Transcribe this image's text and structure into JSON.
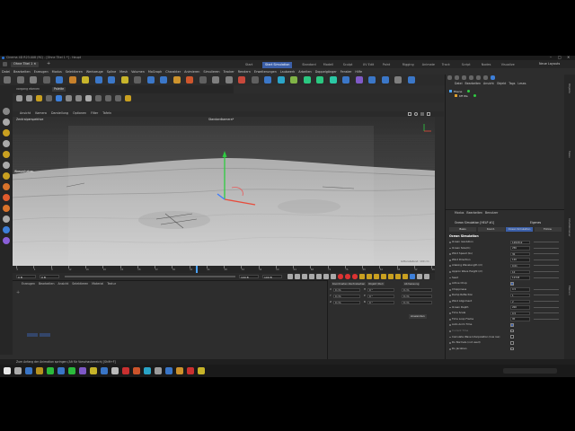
{
  "window": {
    "title": "Cinema 4D R23.008 (RC) - [Ohne Titel 1 *] - Haupt",
    "doc_tab": "Ohne Titel 1",
    "layout_label": "Neue Layouts"
  },
  "top_tabs": [
    "Start",
    "Start Simulation",
    "Standard",
    "Modell",
    "Sculpt",
    "UV Edit",
    "Paint",
    "Rigging",
    "Animate",
    "Track",
    "Script",
    "Nodes",
    "Visualize"
  ],
  "active_top_tab": 1,
  "main_menu": [
    "Datei",
    "Bearbeiten",
    "Erzeugen",
    "Modus",
    "Selektieren",
    "Werkzeuge",
    "Spline",
    "Mesh",
    "Volumen",
    "MoGraph",
    "Charakter",
    "Animieren",
    "Simulieren",
    "Tracker",
    "Rendern",
    "Erweiterungen",
    "Laubwerk",
    "Arbeiten",
    "Doppelgänger",
    "Fenster",
    "Hilfe"
  ],
  "left_strip": {
    "tab1": "vorgang ebenen",
    "tab2": "Palette"
  },
  "viewport": {
    "menu": [
      "Ansicht",
      "Kamera",
      "Darstellung",
      "Optionen",
      "Filter",
      "Tafeln"
    ],
    "camera_label": "Zentralperspektive",
    "default_camera": "Standardkamera*",
    "object_label": "Wasserheben",
    "grid_info": "Gitterabstand: 100 cm"
  },
  "timeline": {
    "ticks": [
      "0",
      "4",
      "8",
      "12",
      "16",
      "20",
      "24",
      "28",
      "32",
      "36",
      "40",
      "44",
      "48",
      "52",
      "56",
      "60",
      "64",
      "68",
      "72",
      "76",
      "80",
      "84",
      "88",
      "92",
      "96"
    ],
    "current_frame": "0 B",
    "start": "0 B",
    "end": "100 B",
    "end2": "100 B"
  },
  "material_manager": {
    "menu": [
      "Erzeugen",
      "Bearbeiten",
      "Ansicht",
      "Selektieren",
      "Material",
      "Textur"
    ]
  },
  "coordinates": {
    "headers": [
      "Koordinaten Zentralsehen",
      "Objekt (Rel)",
      "Abmessung"
    ],
    "rows": [
      {
        "axis": "X",
        "pos": "0 cm",
        "rot_axis": "H",
        "rot": "0 °",
        "size": "0 cm"
      },
      {
        "axis": "Y",
        "pos": "0 cm",
        "rot_axis": "P",
        "rot": "0 °",
        "size": "0 cm"
      },
      {
        "axis": "Z",
        "pos": "0 cm",
        "rot_axis": "B",
        "rot": "0 °",
        "size": "0 cm"
      }
    ],
    "apply": "Anwenden"
  },
  "object_manager": {
    "menu": [
      "Datei",
      "Bearbeiten",
      "Ansicht",
      "Objekt",
      "Tags",
      "Lesez."
    ],
    "objects": [
      {
        "name": "Ebene",
        "depth": 0
      },
      {
        "name": "Kff Wa",
        "depth": 1
      }
    ]
  },
  "attribute_manager": {
    "menu": [
      "Modus",
      "Bearbeiten",
      "Benutzer"
    ],
    "object_title": "Ocean Simulation [HELP #1]",
    "dropdown": "Eigenes",
    "tabs": [
      "Basis",
      "Koord.",
      "Ocean Simulation",
      "Follow"
    ],
    "active_tab": 2,
    "section": "Ocean Simulation",
    "fields": [
      {
        "label": "Ocean resolution",
        "value": "128x512"
      },
      {
        "label": "Ocean Size(m)",
        "value": "256"
      },
      {
        "label": "Wind Speed (ks)",
        "value": "30"
      },
      {
        "label": "Wind Direction",
        "value": "120"
      },
      {
        "label": "Aliasing Wavelength (m)",
        "value": "0.01"
      },
      {
        "label": "Approx Wave Height (m)",
        "value": "10"
      },
      {
        "label": "Seed",
        "value": "12345"
      },
      {
        "label": "Active Chop",
        "value": ""
      },
      {
        "label": "Choppiness",
        "value": "0.5"
      },
      {
        "label": "Damp Reflection",
        "value": "1"
      },
      {
        "label": "Wind Alignment",
        "value": "2"
      },
      {
        "label": "Ocean Depth",
        "value": "200"
      },
      {
        "label": "Time Scale",
        "value": "0.5"
      },
      {
        "label": "Time Loop Frame",
        "value": "90"
      },
      {
        "label": "Auto Anim Time",
        "value": ""
      },
      {
        "label": "Current Time",
        "value": ""
      },
      {
        "label": "Calculate Wave Interpolation (low res)",
        "value": ""
      },
      {
        "label": "Do Normals (not used)",
        "value": ""
      },
      {
        "label": "Do Jacobian",
        "value": ""
      }
    ]
  },
  "right_sidebar": [
    "Objekte",
    "Takes",
    "Inhaltsbrowser",
    "Ebenen"
  ],
  "status_bar": "Zum Anfang der Animation springen (Alt für Vorschaubereich) [Shift+F]",
  "colors": {
    "accent": "#3b5fa8",
    "panel": "#2d2d2d",
    "panel_dark": "#232323",
    "y_axis": "#2ecc40",
    "x_axis": "#e74c3c",
    "timeline_marker": "#4aa3ff"
  }
}
